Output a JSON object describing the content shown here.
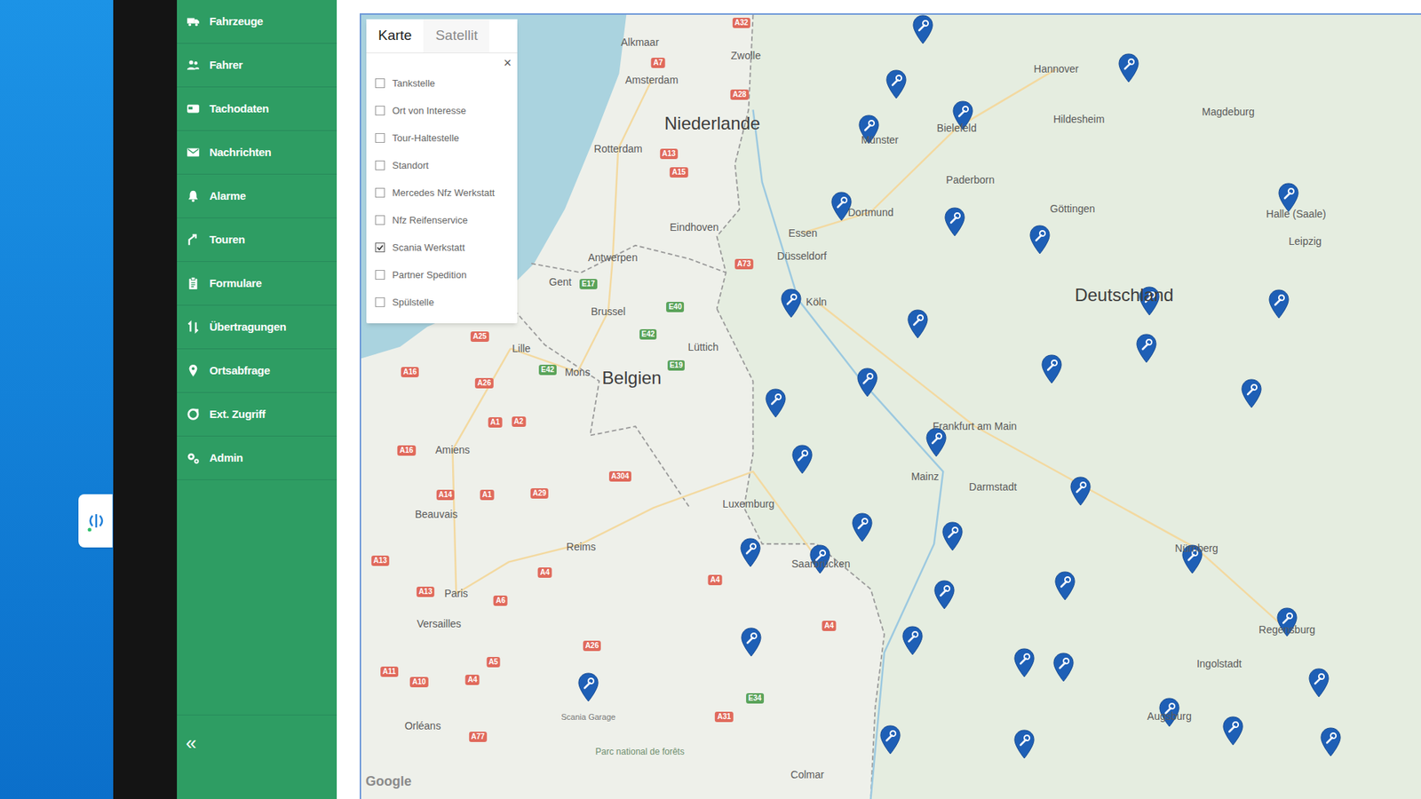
{
  "sidebar": {
    "items": [
      {
        "label": "Fahrzeuge"
      },
      {
        "label": "Fahrer"
      },
      {
        "label": "Tachodaten"
      },
      {
        "label": "Nachrichten"
      },
      {
        "label": "Alarme"
      },
      {
        "label": "Touren"
      },
      {
        "label": "Formulare"
      },
      {
        "label": "Übertragungen"
      },
      {
        "label": "Ortsabfrage"
      },
      {
        "label": "Ext. Zugriff"
      },
      {
        "label": "Admin"
      }
    ],
    "collapse": "«"
  },
  "map": {
    "tabs": [
      {
        "label": "Karte",
        "selected": true
      },
      {
        "label": "Satellit",
        "selected": false
      }
    ],
    "layers": {
      "close": "×",
      "items": [
        {
          "label": "Tankstelle",
          "checked": false
        },
        {
          "label": "Ort von Interesse",
          "checked": false
        },
        {
          "label": "Tour-Haltestelle",
          "checked": false
        },
        {
          "label": "Standort",
          "checked": false
        },
        {
          "label": "Mercedes Nfz Werkstatt",
          "checked": false
        },
        {
          "label": "Nfz Reifenservice",
          "checked": false
        },
        {
          "label": "Scania Werkstatt",
          "checked": true
        },
        {
          "label": "Partner Spedition",
          "checked": false
        },
        {
          "label": "Spülstelle",
          "checked": false
        }
      ]
    },
    "places": [
      {
        "label": "Alkmaar",
        "kind": "city"
      },
      {
        "label": "Zwolle",
        "kind": "city"
      },
      {
        "label": "Amsterdam",
        "kind": "city"
      },
      {
        "label": "Niederlande",
        "kind": "country"
      },
      {
        "label": "Rotterdam",
        "kind": "city"
      },
      {
        "label": "Eindhoven",
        "kind": "city"
      },
      {
        "label": "Antwerpen",
        "kind": "city"
      },
      {
        "label": "Gent",
        "kind": "city"
      },
      {
        "label": "Brussel",
        "kind": "city"
      },
      {
        "label": "Lille",
        "kind": "city"
      },
      {
        "label": "Mons",
        "kind": "city"
      },
      {
        "label": "Belgien",
        "kind": "country"
      },
      {
        "label": "Lüttich",
        "kind": "city"
      },
      {
        "label": "Amiens",
        "kind": "city"
      },
      {
        "label": "Beauvais",
        "kind": "city"
      },
      {
        "label": "Reims",
        "kind": "city"
      },
      {
        "label": "Paris",
        "kind": "city"
      },
      {
        "label": "Versailles",
        "kind": "city"
      },
      {
        "label": "Orléans",
        "kind": "city"
      },
      {
        "label": "Luxemburg",
        "kind": "city"
      },
      {
        "label": "Essen",
        "kind": "city"
      },
      {
        "label": "Düsseldorf",
        "kind": "city"
      },
      {
        "label": "Köln",
        "kind": "city"
      },
      {
        "label": "Münster",
        "kind": "city"
      },
      {
        "label": "Dortmund",
        "kind": "city"
      },
      {
        "label": "Bielefeld",
        "kind": "city"
      },
      {
        "label": "Hannover",
        "kind": "city"
      },
      {
        "label": "Hildesheim",
        "kind": "city"
      },
      {
        "label": "Magdeburg",
        "kind": "city"
      },
      {
        "label": "Paderborn",
        "kind": "city"
      },
      {
        "label": "Göttingen",
        "kind": "city"
      },
      {
        "label": "Deutschland",
        "kind": "country"
      },
      {
        "label": "Frankfurt am Main",
        "kind": "city"
      },
      {
        "label": "Mainz",
        "kind": "city"
      },
      {
        "label": "Darmstadt",
        "kind": "city"
      },
      {
        "label": "Nürnberg",
        "kind": "city"
      },
      {
        "label": "Ingolstadt",
        "kind": "city"
      },
      {
        "label": "Regensburg",
        "kind": "city"
      },
      {
        "label": "Saarbrücken",
        "kind": "city"
      },
      {
        "label": "Colmar",
        "kind": "city"
      },
      {
        "label": "Augsburg",
        "kind": "city"
      },
      {
        "label": "Parc national de forêts",
        "kind": "park"
      },
      {
        "label": "Halle (Saale)",
        "kind": "city"
      },
      {
        "label": "Leipzig",
        "kind": "city"
      }
    ],
    "roads": [
      {
        "label": "A32",
        "kind": "motorway"
      },
      {
        "label": "A7",
        "kind": "motorway"
      },
      {
        "label": "A28",
        "kind": "motorway"
      },
      {
        "label": "A13",
        "kind": "motorway"
      },
      {
        "label": "A15",
        "kind": "motorway"
      },
      {
        "label": "A73",
        "kind": "motorway"
      },
      {
        "label": "A25",
        "kind": "motorway"
      },
      {
        "label": "A16",
        "kind": "motorway"
      },
      {
        "label": "A26",
        "kind": "motorway"
      },
      {
        "label": "A1",
        "kind": "motorway"
      },
      {
        "label": "A2",
        "kind": "motorway"
      },
      {
        "label": "A304",
        "kind": "motorway"
      },
      {
        "label": "A16",
        "kind": "motorway"
      },
      {
        "label": "A14",
        "kind": "motorway"
      },
      {
        "label": "A1",
        "kind": "motorway"
      },
      {
        "label": "A29",
        "kind": "motorway"
      },
      {
        "label": "A13",
        "kind": "motorway"
      },
      {
        "label": "A4",
        "kind": "motorway"
      },
      {
        "label": "A13",
        "kind": "motorway"
      },
      {
        "label": "A6",
        "kind": "motorway"
      },
      {
        "label": "A26",
        "kind": "motorway"
      },
      {
        "label": "A11",
        "kind": "motorway"
      },
      {
        "label": "A10",
        "kind": "motorway"
      },
      {
        "label": "A4",
        "kind": "motorway"
      },
      {
        "label": "A5",
        "kind": "motorway"
      },
      {
        "label": "A77",
        "kind": "motorway"
      },
      {
        "label": "A31",
        "kind": "motorway"
      },
      {
        "label": "A4",
        "kind": "motorway"
      },
      {
        "label": "A4",
        "kind": "motorway"
      },
      {
        "label": "E40",
        "kind": "euro"
      },
      {
        "label": "E42",
        "kind": "euro"
      },
      {
        "label": "E42",
        "kind": "euro"
      },
      {
        "label": "E19",
        "kind": "euro"
      },
      {
        "label": "E17",
        "kind": "euro"
      },
      {
        "label": "E34",
        "kind": "euro"
      }
    ],
    "markers": [
      {},
      {},
      {},
      {},
      {},
      {},
      {},
      {},
      {},
      {},
      {},
      {},
      {},
      {},
      {},
      {},
      {},
      {},
      {},
      {},
      {},
      {},
      {},
      {},
      {},
      {},
      {},
      {},
      {},
      {},
      {},
      {
        "label": "Scania Garage"
      },
      {},
      {},
      {},
      {},
      {},
      {},
      {},
      {}
    ],
    "attribution": "Google"
  }
}
